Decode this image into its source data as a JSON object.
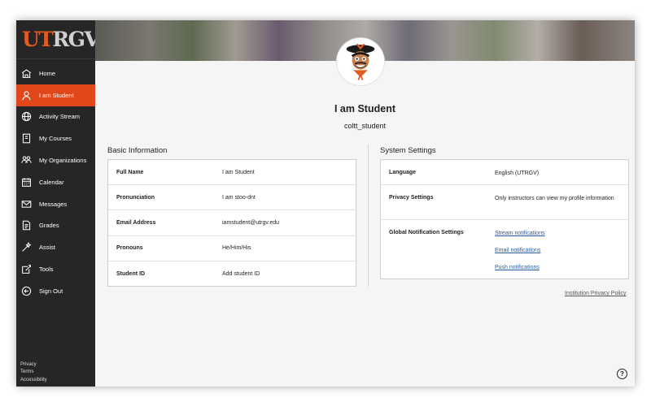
{
  "brand": {
    "logo_ut": "UT",
    "logo_rgv": "RGV"
  },
  "nav": {
    "items": [
      {
        "label": "Home",
        "icon": "home-icon"
      },
      {
        "label": "I am Student",
        "icon": "user-icon",
        "active": true
      },
      {
        "label": "Activity Stream",
        "icon": "globe-icon"
      },
      {
        "label": "My Courses",
        "icon": "book-icon"
      },
      {
        "label": "My Organizations",
        "icon": "organizations-icon"
      },
      {
        "label": "Calendar",
        "icon": "calendar-icon"
      },
      {
        "label": "Messages",
        "icon": "envelope-icon"
      },
      {
        "label": "Grades",
        "icon": "grades-icon"
      },
      {
        "label": "Assist",
        "icon": "assist-icon"
      },
      {
        "label": "Tools",
        "icon": "tools-icon"
      },
      {
        "label": "Sign Out",
        "icon": "sign-out-icon"
      }
    ],
    "footer": [
      "Privacy",
      "Terms",
      "Accessibility"
    ]
  },
  "profile": {
    "name": "I am Student",
    "username": "coltt_student"
  },
  "basic_info": {
    "title": "Basic Information",
    "rows": [
      {
        "label": "Full Name",
        "value": "I am Student"
      },
      {
        "label": "Pronunciation",
        "value": "I am stoo-dnt"
      },
      {
        "label": "Email Address",
        "value": "iamstudent@utrgv.edu"
      },
      {
        "label": "Pronouns",
        "value": "He/Him/His"
      },
      {
        "label": "Student ID",
        "value": "Add student ID"
      }
    ]
  },
  "system_settings": {
    "title": "System Settings",
    "language_label": "Language",
    "language_value": "English (UTRGV)",
    "privacy_label": "Privacy Settings",
    "privacy_value": "Only instructors can view my profile information",
    "notifications_label": "Global Notification Settings",
    "notification_links": [
      "Stream notifications",
      "Email notifications",
      "Push notifications"
    ]
  },
  "institution_privacy_policy": "Institution Privacy Policy",
  "help_symbol": "?",
  "colors": {
    "accent": "#e0471a",
    "sidebar_bg": "#262626",
    "link": "#2a5d9c"
  }
}
